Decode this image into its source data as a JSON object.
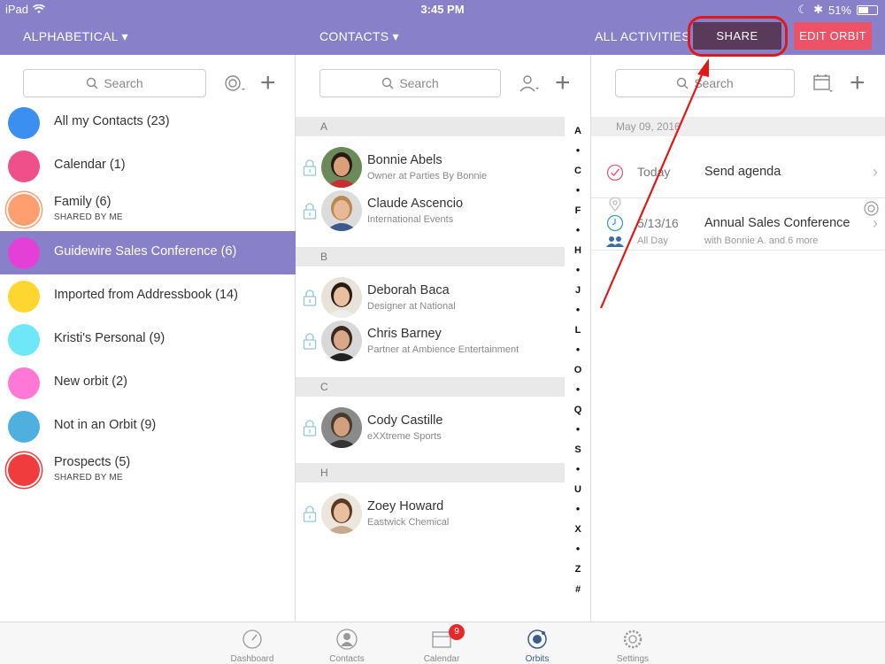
{
  "status": {
    "carrier": "iPad",
    "time": "3:45 PM",
    "battery": "51%"
  },
  "header": {
    "alpha_label": "ALPHABETICAL ▾",
    "contacts_label": "CONTACTS ▾",
    "activities_label": "ALL ACTIVITIES ▾",
    "share_label": "SHARE",
    "edit_label": "EDIT ORBIT"
  },
  "orbits": {
    "search_placeholder": "Search",
    "items": [
      {
        "name": "All my Contacts (23)",
        "color": "#3a8ff0",
        "sub": "",
        "selected": false,
        "ring": false
      },
      {
        "name": "Calendar (1)",
        "color": "#f0508a",
        "sub": "",
        "selected": false,
        "ring": false
      },
      {
        "name": "Family (6)",
        "color": "#ff9f70",
        "sub": "SHARED BY ME",
        "selected": false,
        "ring": true
      },
      {
        "name": "Guidewire Sales Conference (6)",
        "color": "#e440d8",
        "sub": "",
        "selected": true,
        "ring": false
      },
      {
        "name": "Imported from Addressbook (14)",
        "color": "#ffd630",
        "sub": "",
        "selected": false,
        "ring": false
      },
      {
        "name": "Kristi's Personal (9)",
        "color": "#6ee8f8",
        "sub": "",
        "selected": false,
        "ring": false
      },
      {
        "name": "New orbit (2)",
        "color": "#ff78d6",
        "sub": "",
        "selected": false,
        "ring": false
      },
      {
        "name": "Not in an Orbit (9)",
        "color": "#4fb0e0",
        "sub": "",
        "selected": false,
        "ring": false
      },
      {
        "name": "Prospects (5)",
        "color": "#f03c3c",
        "sub": "SHARED BY ME",
        "selected": false,
        "ring": true
      }
    ]
  },
  "contacts": {
    "search_placeholder": "Search",
    "sections": [
      {
        "letter": "A",
        "people": [
          {
            "name": "Bonnie  Abels",
            "title": "Owner at Parties By Bonnie",
            "skin": "#d9a07a",
            "hair": "#2a1a12",
            "shirt": "#c83030",
            "bg": "#6a8a5a"
          },
          {
            "name": "Claude Ascencio",
            "title": "International Events",
            "skin": "#e8b898",
            "hair": "#b88a50",
            "shirt": "#3a5a8a",
            "bg": "#dcdcdc"
          }
        ]
      },
      {
        "letter": "B",
        "people": [
          {
            "name": "Deborah Baca",
            "title": "Designer at National",
            "skin": "#e8c0a0",
            "hair": "#2a1a12",
            "shirt": "#eeeeee",
            "bg": "#e8e2d8"
          },
          {
            "name": "Chris Barney",
            "title": "Partner at Ambience Entertainment",
            "skin": "#d8a888",
            "hair": "#3a2a1e",
            "shirt": "#222",
            "bg": "#d8d8d8"
          }
        ]
      },
      {
        "letter": "C",
        "people": [
          {
            "name": "Cody Castille",
            "title": "eXXtreme Sports",
            "skin": "#d0a080",
            "hair": "#4a3a2a",
            "shirt": "#333",
            "bg": "#8a8a8a"
          }
        ]
      },
      {
        "letter": "H",
        "people": [
          {
            "name": "Zoey Howard",
            "title": "Eastwick Chemical",
            "skin": "#e8c0a0",
            "hair": "#5a3a22",
            "shirt": "#c8a890",
            "bg": "#ece6dc"
          }
        ]
      }
    ],
    "index": [
      "A",
      "●",
      "C",
      "●",
      "F",
      "●",
      "H",
      "●",
      "J",
      "●",
      "L",
      "●",
      "O",
      "●",
      "Q",
      "●",
      "S",
      "●",
      "U",
      "●",
      "X",
      "●",
      "Z",
      "#"
    ]
  },
  "activities": {
    "search_placeholder": "Search",
    "date": "May 09, 2016",
    "items": [
      {
        "time": "Today",
        "time_sub": "",
        "title": "Send agenda",
        "sub": ""
      },
      {
        "time": "5/13/16",
        "time_sub": "All Day",
        "title": "Annual Sales Conference",
        "sub": "with Bonnie  A. and 6 more"
      }
    ]
  },
  "tabs": [
    {
      "label": "Dashboard",
      "icon": "gauge-icon"
    },
    {
      "label": "Contacts",
      "icon": "person-icon"
    },
    {
      "label": "Calendar",
      "icon": "calendar-icon",
      "badge": "9"
    },
    {
      "label": "Orbits",
      "icon": "orbit-icon",
      "active": true
    },
    {
      "label": "Settings",
      "icon": "gear-icon"
    }
  ]
}
